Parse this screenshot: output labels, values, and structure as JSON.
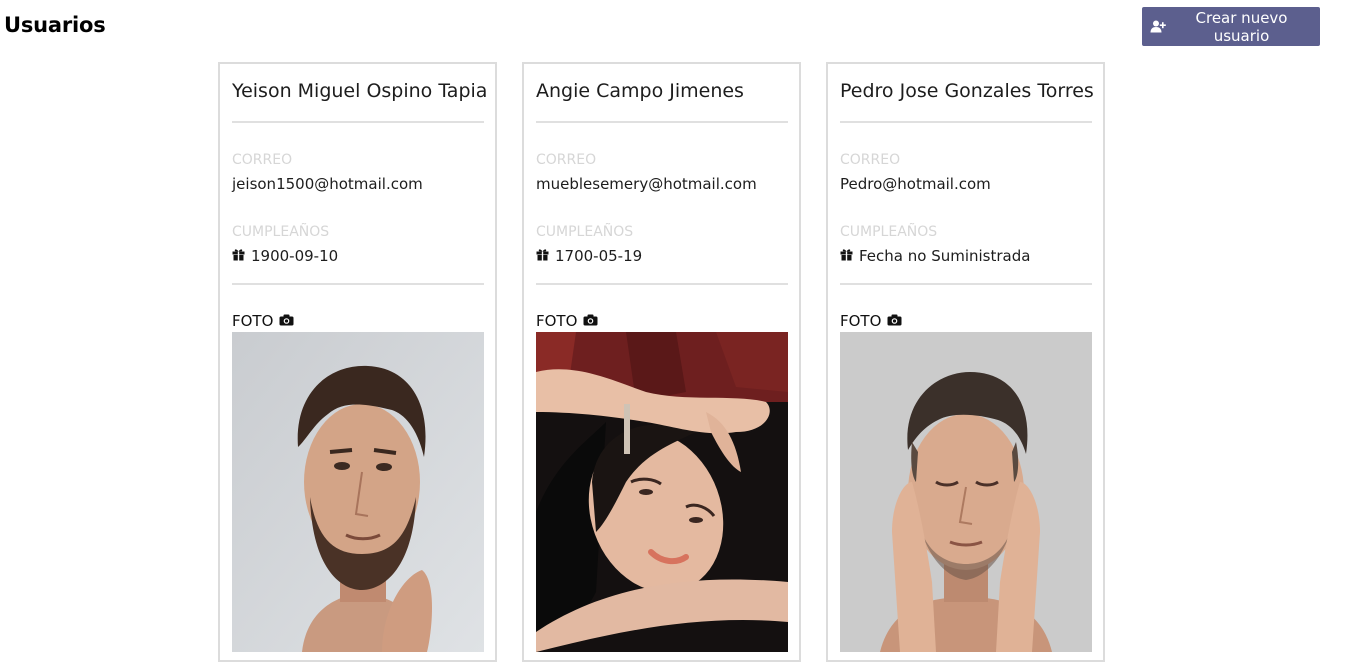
{
  "header": {
    "title": "Usuarios",
    "create_button_label": "Crear nuevo usuario",
    "create_button_icon": "user-plus-icon",
    "create_button_color": "#5c5f8e"
  },
  "labels": {
    "email": "CORREO",
    "birthday": "CUMPLEAÑOS",
    "photo": "FOTO"
  },
  "users": [
    {
      "name": "Yeison Miguel Ospino Tapia",
      "email": "jeison1500@hotmail.com",
      "birthday": "1900-09-10",
      "photo": "portrait-photo-man-bearded"
    },
    {
      "name": "Angie Campo Jimenes",
      "email": "mueblesemery@hotmail.com",
      "birthday": "1700-05-19",
      "photo": "portrait-photo-woman"
    },
    {
      "name": "Pedro Jose Gonzales Torres",
      "email": "Pedro@hotmail.com",
      "birthday": "Fecha no Suministrada",
      "photo": "portrait-photo-man-eyes-closed"
    }
  ]
}
